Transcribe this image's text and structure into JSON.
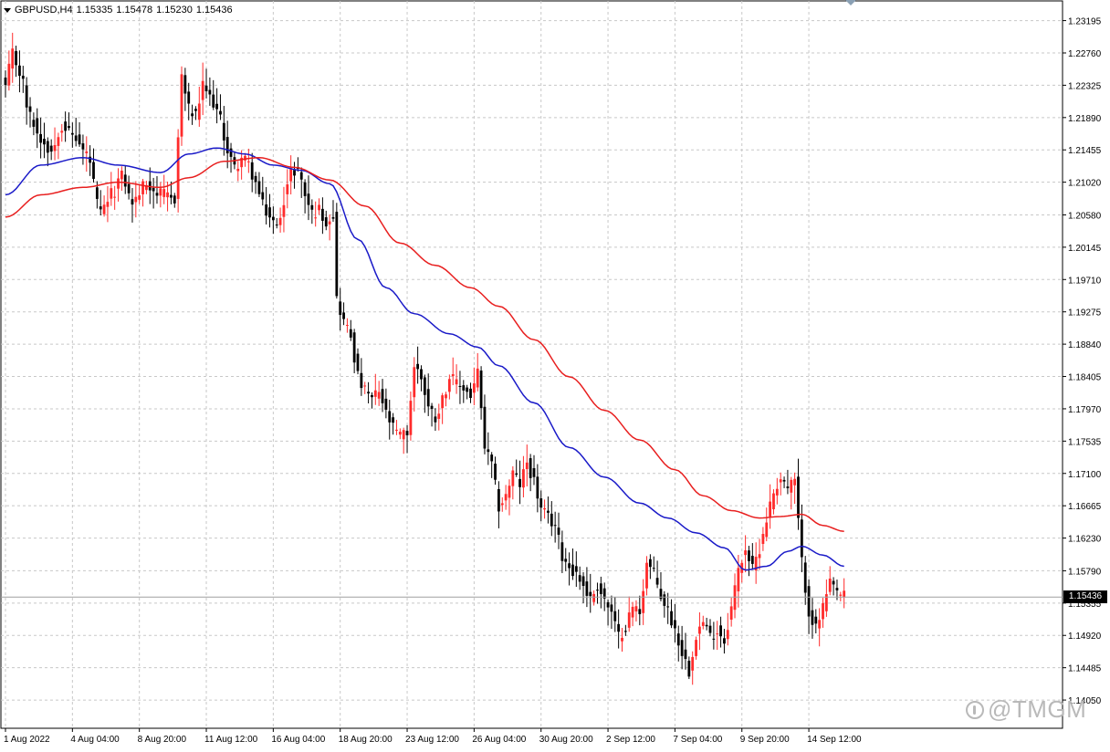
{
  "header": {
    "symbol": "GBPUSD,H4",
    "open": "1.15335",
    "high": "1.15478",
    "low": "1.15230",
    "close": "1.15436"
  },
  "watermark": {
    "text": "@TMGM",
    "icon": "circle-logo-icon"
  },
  "colors": {
    "bull": "#ff2b2b",
    "bear": "#000000",
    "ma_fast": "#1a1ac8",
    "ma_slow": "#e81f1f",
    "grid": "#c8c8c8",
    "price_line": "#a0a0a0"
  },
  "chart_data": {
    "type": "candlestick",
    "symbol": "GBPUSD",
    "timeframe": "H4",
    "current_price": 1.15436,
    "current_price_label": "1.15436",
    "y_ticks": [
      "1.23195",
      "1.22760",
      "1.22325",
      "1.21890",
      "1.21455",
      "1.21020",
      "1.20580",
      "1.20145",
      "1.19710",
      "1.19275",
      "1.18840",
      "1.18405",
      "1.17970",
      "1.17535",
      "1.17100",
      "1.16665",
      "1.16230",
      "1.15790",
      "1.15355",
      "1.14920",
      "1.14485",
      "1.14050"
    ],
    "ylim": [
      1.1367,
      1.2346
    ],
    "x_labels": [
      {
        "index": 0,
        "label": "1 Aug 2022"
      },
      {
        "index": 19,
        "label": "4 Aug 04:00"
      },
      {
        "index": 38,
        "label": "8 Aug 20:00"
      },
      {
        "index": 57,
        "label": "11 Aug 12:00"
      },
      {
        "index": 76,
        "label": "16 Aug 04:00"
      },
      {
        "index": 95,
        "label": "18 Aug 20:00"
      },
      {
        "index": 114,
        "label": "23 Aug 12:00"
      },
      {
        "index": 133,
        "label": "26 Aug 04:00"
      },
      {
        "index": 152,
        "label": "30 Aug 20:00"
      },
      {
        "index": 171,
        "label": "2 Sep 12:00"
      },
      {
        "index": 190,
        "label": "7 Sep 04:00"
      },
      {
        "index": 209,
        "label": "9 Sep 20:00"
      },
      {
        "index": 228,
        "label": "14 Sep 12:00"
      }
    ],
    "close_anchors": [
      [
        0,
        1.223
      ],
      [
        2,
        1.2275
      ],
      [
        4,
        1.225
      ],
      [
        7,
        1.219
      ],
      [
        10,
        1.216
      ],
      [
        13,
        1.2145
      ],
      [
        16,
        1.218
      ],
      [
        19,
        1.2165
      ],
      [
        23,
        1.214
      ],
      [
        27,
        1.206
      ],
      [
        30,
        1.2085
      ],
      [
        33,
        1.211
      ],
      [
        36,
        1.2075
      ],
      [
        40,
        1.21
      ],
      [
        44,
        1.2085
      ],
      [
        48,
        1.208
      ],
      [
        50,
        1.2245
      ],
      [
        52,
        1.22
      ],
      [
        54,
        1.219
      ],
      [
        56,
        1.223
      ],
      [
        59,
        1.221
      ],
      [
        61,
        1.2185
      ],
      [
        63,
        1.2145
      ],
      [
        65,
        1.212
      ],
      [
        67,
        1.2135
      ],
      [
        69,
        1.2125
      ],
      [
        71,
        1.21
      ],
      [
        73,
        1.207
      ],
      [
        75,
        1.2055
      ],
      [
        77,
        1.204
      ],
      [
        79,
        1.208
      ],
      [
        81,
        1.2115
      ],
      [
        83,
        1.212
      ],
      [
        85,
        1.2085
      ],
      [
        87,
        1.206
      ],
      [
        89,
        1.2065
      ],
      [
        91,
        1.205
      ],
      [
        93,
        1.206
      ],
      [
        94,
        1.1945
      ],
      [
        96,
        1.1915
      ],
      [
        98,
        1.1895
      ],
      [
        100,
        1.184
      ],
      [
        102,
        1.182
      ],
      [
        104,
        1.181
      ],
      [
        106,
        1.182
      ],
      [
        108,
        1.179
      ],
      [
        110,
        1.177
      ],
      [
        112,
        1.176
      ],
      [
        114,
        1.1765
      ],
      [
        116,
        1.1855
      ],
      [
        118,
        1.184
      ],
      [
        120,
        1.18
      ],
      [
        122,
        1.1785
      ],
      [
        124,
        1.181
      ],
      [
        126,
        1.184
      ],
      [
        128,
        1.183
      ],
      [
        130,
        1.1825
      ],
      [
        132,
        1.1815
      ],
      [
        134,
        1.1845
      ],
      [
        136,
        1.1745
      ],
      [
        138,
        1.172
      ],
      [
        140,
        1.1665
      ],
      [
        142,
        1.168
      ],
      [
        144,
        1.171
      ],
      [
        146,
        1.1695
      ],
      [
        148,
        1.1725
      ],
      [
        150,
        1.17
      ],
      [
        152,
        1.166
      ],
      [
        154,
        1.165
      ],
      [
        156,
        1.164
      ],
      [
        158,
        1.16
      ],
      [
        160,
        1.1585
      ],
      [
        162,
        1.1575
      ],
      [
        164,
        1.156
      ],
      [
        166,
        1.154
      ],
      [
        168,
        1.156
      ],
      [
        170,
        1.154
      ],
      [
        172,
        1.152
      ],
      [
        174,
        1.149
      ],
      [
        176,
        1.1505
      ],
      [
        178,
        1.153
      ],
      [
        180,
        1.1525
      ],
      [
        182,
        1.159
      ],
      [
        184,
        1.1575
      ],
      [
        186,
        1.1545
      ],
      [
        188,
        1.1525
      ],
      [
        190,
        1.15
      ],
      [
        192,
        1.147
      ],
      [
        194,
        1.1445
      ],
      [
        196,
        1.1495
      ],
      [
        198,
        1.151
      ],
      [
        200,
        1.149
      ],
      [
        202,
        1.15
      ],
      [
        204,
        1.1485
      ],
      [
        206,
        1.153
      ],
      [
        208,
        1.158
      ],
      [
        210,
        1.161
      ],
      [
        212,
        1.158
      ],
      [
        214,
        1.161
      ],
      [
        216,
        1.165
      ],
      [
        218,
        1.1685
      ],
      [
        220,
        1.1705
      ],
      [
        222,
        1.169
      ],
      [
        224,
        1.17
      ],
      [
        226,
        1.159
      ],
      [
        228,
        1.1525
      ],
      [
        230,
        1.15
      ],
      [
        232,
        1.153
      ],
      [
        234,
        1.156
      ],
      [
        236,
        1.155
      ],
      [
        238,
        1.15436
      ]
    ],
    "series": [
      {
        "style": "line",
        "color": "#1a1ac8",
        "anchors": [
          [
            0,
            1.2085
          ],
          [
            10,
            1.2125
          ],
          [
            22,
            1.2135
          ],
          [
            32,
            1.2125
          ],
          [
            44,
            1.2115
          ],
          [
            52,
            1.214
          ],
          [
            60,
            1.2148
          ],
          [
            68,
            1.214
          ],
          [
            76,
            1.2125
          ],
          [
            84,
            1.2118
          ],
          [
            92,
            1.21
          ],
          [
            100,
            1.2025
          ],
          [
            108,
            1.196
          ],
          [
            116,
            1.1925
          ],
          [
            126,
            1.1898
          ],
          [
            134,
            1.188
          ],
          [
            140,
            1.1855
          ],
          [
            150,
            1.1805
          ],
          [
            160,
            1.1745
          ],
          [
            170,
            1.1705
          ],
          [
            180,
            1.167
          ],
          [
            188,
            1.165
          ],
          [
            196,
            1.163
          ],
          [
            204,
            1.161
          ],
          [
            210,
            1.158
          ],
          [
            216,
            1.1585
          ],
          [
            222,
            1.1605
          ],
          [
            226,
            1.1612
          ],
          [
            232,
            1.16
          ],
          [
            238,
            1.1585
          ]
        ]
      },
      {
        "style": "line",
        "color": "#e81f1f",
        "anchors": [
          [
            0,
            1.2055
          ],
          [
            10,
            1.2085
          ],
          [
            22,
            1.2095
          ],
          [
            32,
            1.2102
          ],
          [
            44,
            1.2095
          ],
          [
            52,
            1.2108
          ],
          [
            62,
            1.213
          ],
          [
            72,
            1.2135
          ],
          [
            82,
            1.2122
          ],
          [
            92,
            1.2105
          ],
          [
            102,
            1.207
          ],
          [
            112,
            1.202
          ],
          [
            122,
            1.199
          ],
          [
            132,
            1.196
          ],
          [
            140,
            1.1935
          ],
          [
            150,
            1.189
          ],
          [
            160,
            1.184
          ],
          [
            170,
            1.1795
          ],
          [
            180,
            1.1755
          ],
          [
            190,
            1.1715
          ],
          [
            198,
            1.168
          ],
          [
            206,
            1.166
          ],
          [
            214,
            1.165
          ],
          [
            220,
            1.1652
          ],
          [
            226,
            1.1655
          ],
          [
            232,
            1.164
          ],
          [
            238,
            1.1632
          ]
        ]
      }
    ]
  }
}
